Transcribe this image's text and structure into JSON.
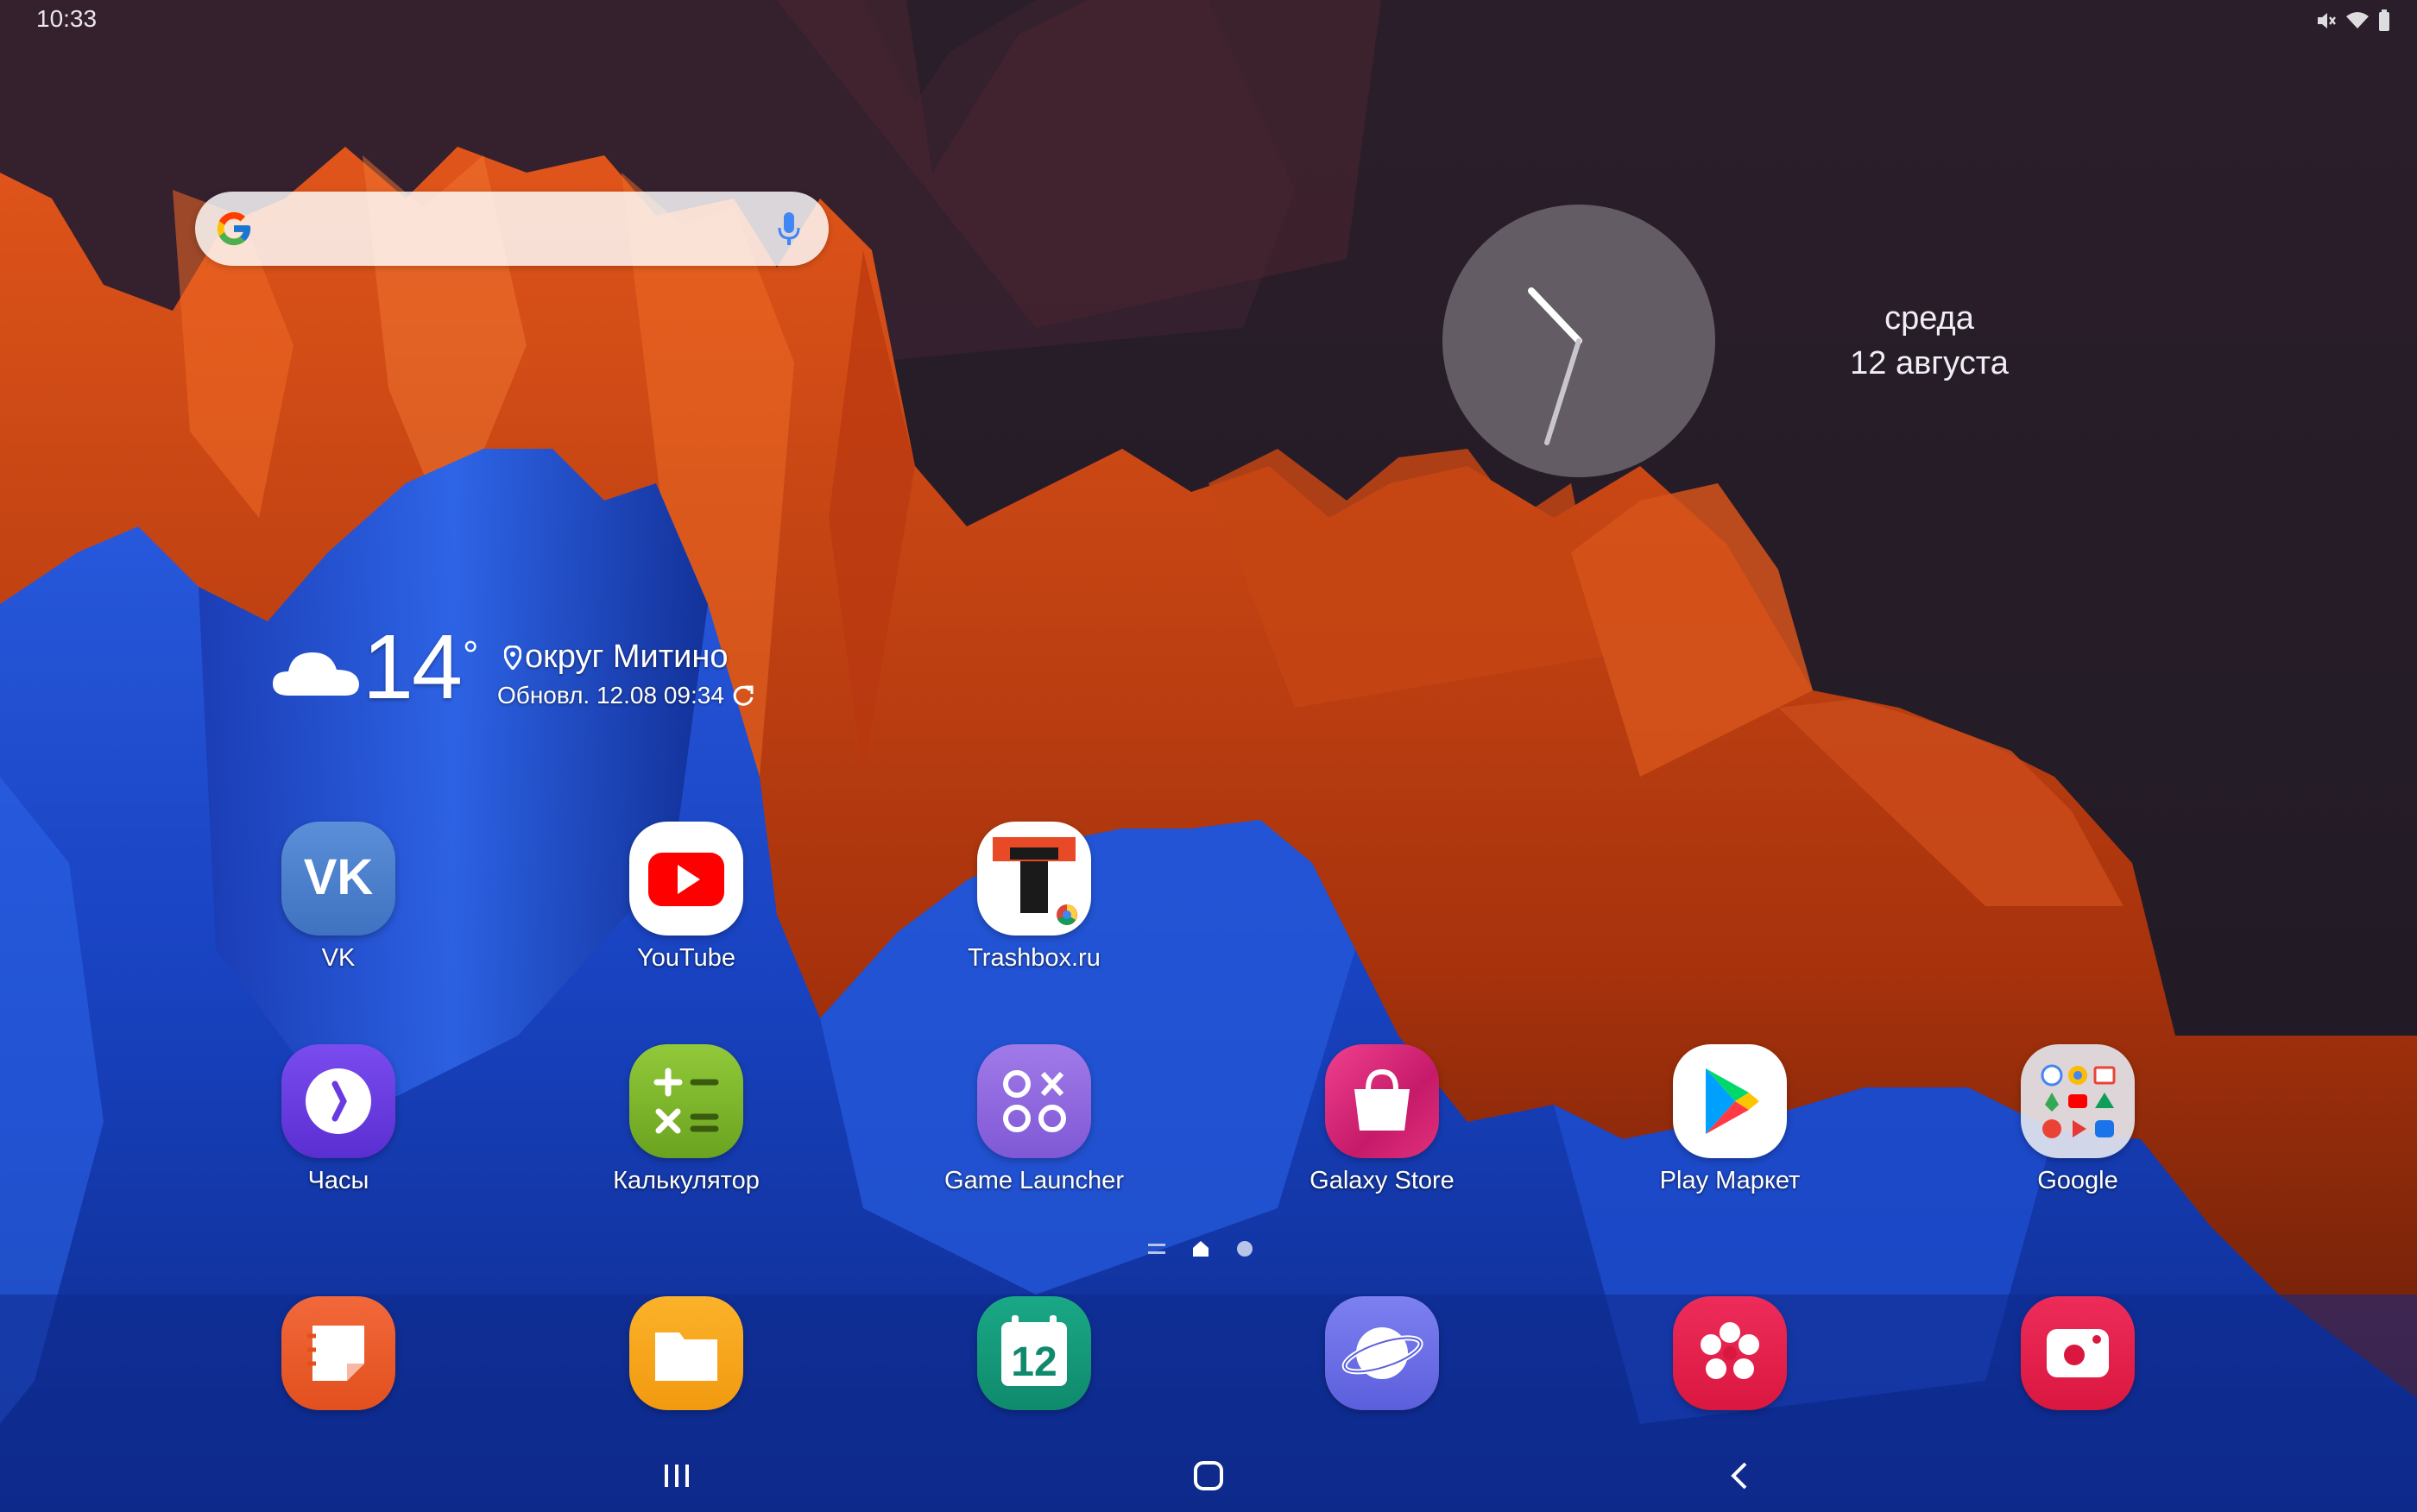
{
  "status_bar": {
    "time": "10:33",
    "icons": [
      "mute-icon",
      "wifi-icon",
      "battery-icon"
    ]
  },
  "search_widget": {
    "logo": "google-g-icon",
    "voice": "mic-icon"
  },
  "clock_widget": {
    "day": "среда",
    "date": "12 августа"
  },
  "weather_widget": {
    "icon": "cloud-icon",
    "temperature": "14",
    "degree": "°",
    "location": "округ Митино",
    "updated": "Обновл. 12.08 09:34"
  },
  "apps_row1": [
    {
      "label": "VK",
      "icon": "vk-icon"
    },
    {
      "label": "YouTube",
      "icon": "youtube-icon"
    },
    {
      "label": "Trashbox.ru",
      "icon": "trashbox-icon"
    }
  ],
  "apps_row2": [
    {
      "label": "Часы",
      "icon": "clock-app-icon"
    },
    {
      "label": "Калькулятор",
      "icon": "calculator-icon"
    },
    {
      "label": "Game Launcher",
      "icon": "game-launcher-icon"
    },
    {
      "label": "Galaxy Store",
      "icon": "galaxy-store-icon"
    },
    {
      "label": "Play Маркет",
      "icon": "play-store-icon"
    },
    {
      "label": "Google",
      "icon": "google-folder-icon"
    }
  ],
  "dock": [
    {
      "icon": "samsung-notes-icon"
    },
    {
      "icon": "my-files-icon"
    },
    {
      "icon": "calendar-icon",
      "text": "12"
    },
    {
      "icon": "samsung-internet-icon"
    },
    {
      "icon": "gallery-icon"
    },
    {
      "icon": "screen-recorder-icon"
    }
  ],
  "page_indicator": {
    "pages": [
      "menu",
      "home",
      "page"
    ],
    "active": 1
  },
  "nav_bar": [
    "recents-icon",
    "home-icon",
    "back-icon"
  ],
  "colors": {
    "vk": "#4a80c8",
    "youtube": "#ff0000",
    "clock": "#6a3ae0",
    "calculator": "#7fb82b",
    "game_launcher": "#8e6ad8",
    "galaxy_store": "#e0307a",
    "notes": "#f06030",
    "files": "#f7a01a",
    "calendar": "#13997a",
    "internet": "#6b6fe6",
    "gallery": "#e5204c",
    "recorder": "#e5204c"
  }
}
